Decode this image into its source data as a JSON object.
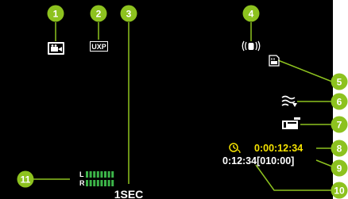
{
  "colors": {
    "screen": "#000000",
    "callout": "#8dc21f",
    "timecode": "#f5e200",
    "icon": "#ffffff",
    "level_bar": "#3cb549"
  },
  "icons": {
    "mode": "video-camera-mode-icon",
    "quality": "uxp-quality-icon",
    "stabilizer": "hand-shake-stabilizer-icon",
    "media": "sd-card-media-icon",
    "wind": "wind-cut-icon",
    "zoom_mic": "zoom-mic-icon",
    "interval": "interval-timer-icon"
  },
  "hud": {
    "quality": "UXP",
    "interval": "1SEC",
    "time_counter": "0:00:12:34",
    "remaining": "0:12:34[010:00]",
    "level_left": "L",
    "level_right": "R"
  },
  "callouts": [
    {
      "number": "1"
    },
    {
      "number": "2"
    },
    {
      "number": "3"
    },
    {
      "number": "4"
    },
    {
      "number": "5"
    },
    {
      "number": "6"
    },
    {
      "number": "7"
    },
    {
      "number": "8"
    },
    {
      "number": "9"
    },
    {
      "number": "10"
    },
    {
      "number": "11"
    }
  ],
  "levels": {
    "left": 1.0,
    "right": 1.0
  }
}
